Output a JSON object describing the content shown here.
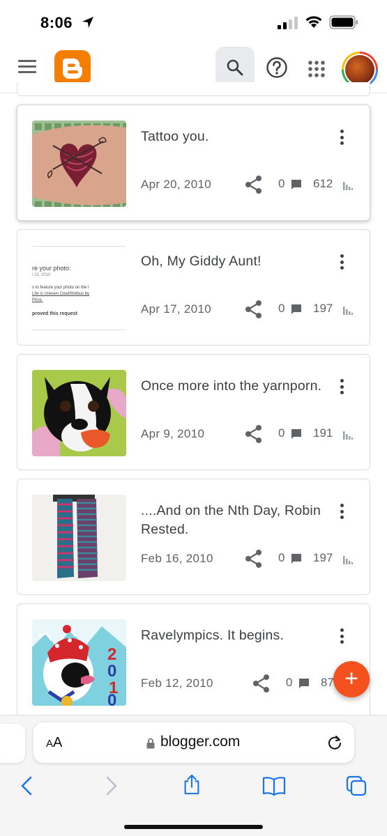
{
  "status_bar": {
    "time": "8:06",
    "icons": [
      "location-arrow-icon",
      "cellular-signal-icon",
      "wifi-icon",
      "battery-icon"
    ]
  },
  "app_bar": {
    "menu_icon": "hamburger-menu-icon",
    "logo": "blogger-logo",
    "search_icon": "search-icon",
    "help_icon": "help-icon",
    "apps_icon": "apps-grid-icon",
    "avatar": "account-avatar"
  },
  "posts": [
    {
      "title": "Tattoo you.",
      "date": "Apr 20, 2010",
      "comments": "0",
      "views": "612"
    },
    {
      "title": "Oh, My Giddy Aunt!",
      "date": "Apr 17, 2010",
      "comments": "0",
      "views": "197",
      "thumb_text": [
        "re your photo:",
        "l 15, 2010",
        "s to feature your photo on the l",
        "Life is Uneven Cowl/Molbus by",
        "Price.",
        "proved this request"
      ]
    },
    {
      "title": "Once more into the yarnporn.",
      "date": "Apr 9, 2010",
      "comments": "0",
      "views": "191"
    },
    {
      "title": "....And on the Nth Day, Robin Rested.",
      "date": "Feb 16, 2010",
      "comments": "0",
      "views": "197"
    },
    {
      "title": "Ravelympics. It begins.",
      "date": "Feb 12, 2010",
      "comments": "0",
      "views": "87",
      "thumb_text": "2010"
    }
  ],
  "fab": {
    "label": "+"
  },
  "browser": {
    "aa_label_small": "A",
    "aa_label": "A",
    "url": "blogger.com",
    "icons": [
      "back-icon",
      "forward-icon",
      "share-icon",
      "bookmarks-icon",
      "tabs-icon"
    ]
  },
  "colors": {
    "brand": "#f57d00",
    "fab": "#f4511e",
    "text": "#3c4043",
    "muted": "#5f6368"
  }
}
